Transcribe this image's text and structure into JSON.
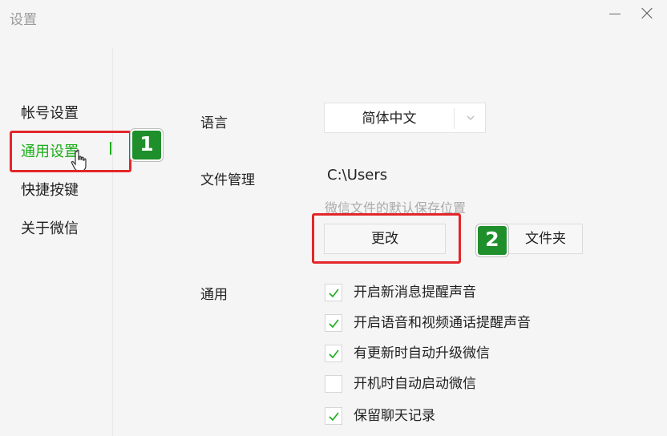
{
  "window": {
    "title": "设置"
  },
  "sidebar": {
    "items": [
      {
        "label": "帐号设置",
        "active": false
      },
      {
        "label": "通用设置",
        "active": true
      },
      {
        "label": "快捷按键",
        "active": false
      },
      {
        "label": "关于微信",
        "active": false
      }
    ]
  },
  "settings": {
    "language": {
      "label": "语言",
      "value": "简体中文"
    },
    "file_management": {
      "label": "文件管理",
      "path": "C:\\Users",
      "hint": "微信文件的默认保存位置",
      "change_button": "更改",
      "open_folder_button": "文件夹"
    },
    "general": {
      "label": "通用",
      "options": [
        {
          "label": "开启新消息提醒声音",
          "checked": true
        },
        {
          "label": "开启语音和视频通话提醒声音",
          "checked": true
        },
        {
          "label": "有更新时自动升级微信",
          "checked": true
        },
        {
          "label": "开机时自动启动微信",
          "checked": false
        },
        {
          "label": "保留聊天记录",
          "checked": true
        }
      ]
    }
  },
  "annotations": {
    "step1": "1",
    "step2": "2"
  },
  "colors": {
    "accent": "#1aad19",
    "highlight": "#e3262a",
    "badge": "#1f8f2c"
  }
}
